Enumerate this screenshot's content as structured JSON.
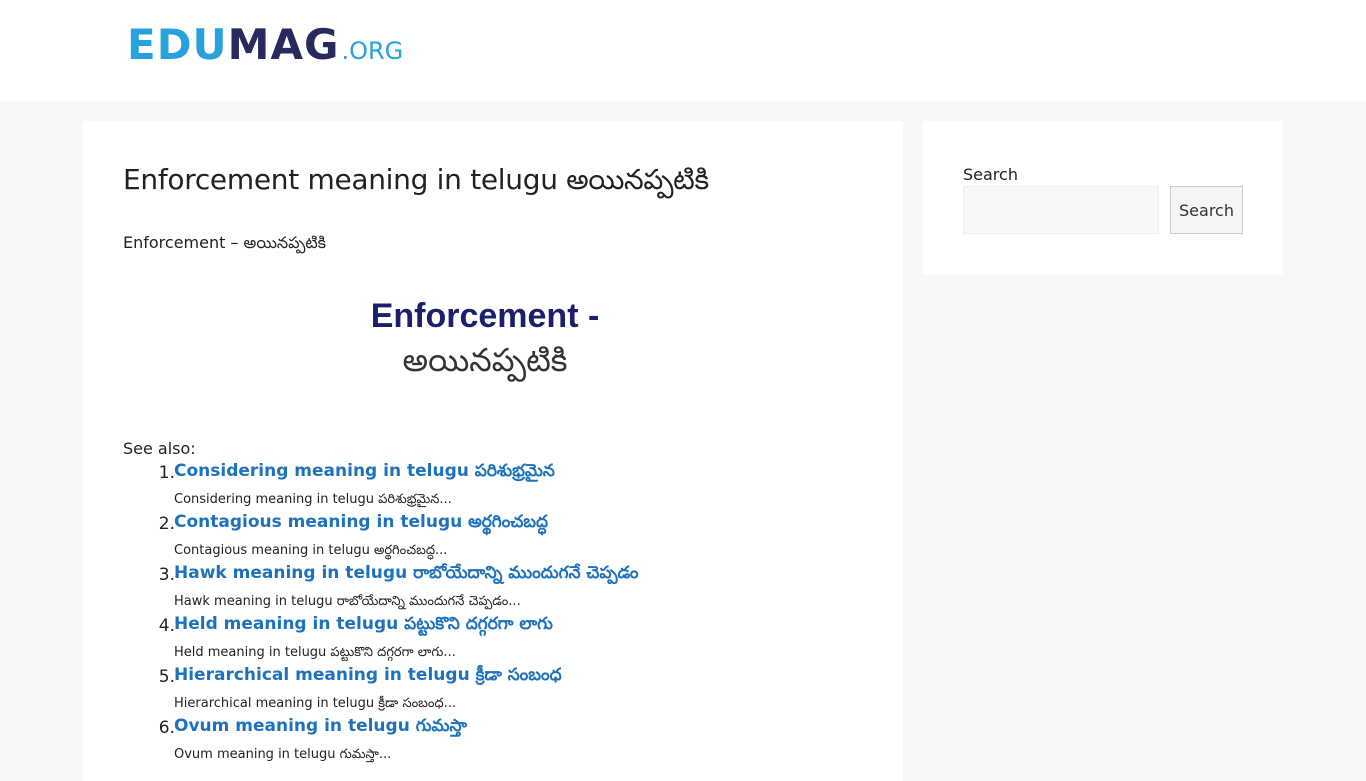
{
  "header": {
    "logo": {
      "part1": "EDU",
      "part2": "MAG",
      "part3": ".ORG"
    }
  },
  "article": {
    "title": "Enforcement meaning in telugu అయినప్పటికి",
    "intro": "Enforcement – అయినప్పటికి",
    "image": {
      "line1": "Enforcement -",
      "line2": "అయినప్పటికి"
    },
    "see_also_label": "See also:",
    "related": [
      {
        "num": "1.",
        "title": "Considering meaning in telugu పరిశుభ్రమైన",
        "excerpt": "Considering meaning in telugu పరిశుభ్రమైన..."
      },
      {
        "num": "2.",
        "title": "Contagious meaning in telugu అర్థగించబద్ధ",
        "excerpt": "Contagious meaning in telugu అర్థగించబద్ధ..."
      },
      {
        "num": "3.",
        "title": "Hawk meaning in telugu రాబోయేదాన్ని ముందుగనే చెప్పడం",
        "excerpt": "Hawk meaning in telugu రాబోయేదాన్ని ముందుగనే చెప్పడం..."
      },
      {
        "num": "4.",
        "title": "Held meaning in telugu పట్టుకొని దగ్గరగా లాగు",
        "excerpt": "Held meaning in telugu పట్టుకొని దగ్గరగా లాగు..."
      },
      {
        "num": "5.",
        "title": "Hierarchical meaning in telugu క్రీడా సంబంధ",
        "excerpt": "Hierarchical meaning in telugu క్రీడా సంబంధ..."
      },
      {
        "num": "6.",
        "title": "Ovum meaning in telugu గుమస్తా",
        "excerpt": "Ovum meaning in telugu గుమస్తా..."
      }
    ]
  },
  "sidebar": {
    "search_label": "Search",
    "search_value": "",
    "search_placeholder": "",
    "search_button": "Search"
  },
  "colors": {
    "logo_light": "#27a2dc",
    "logo_dark": "#262a5c",
    "link": "#1e72bd",
    "page_bg": "#f7f8f9"
  }
}
